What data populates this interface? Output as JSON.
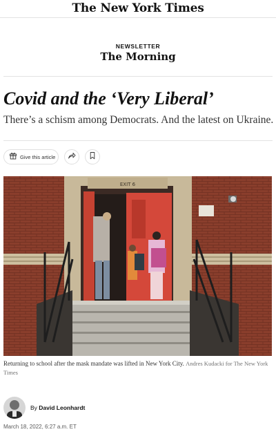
{
  "header": {
    "masthead": "The New York Times"
  },
  "newsletter": {
    "kicker": "NEWSLETTER",
    "title": "The Morning"
  },
  "article": {
    "headline": "Covid and the ‘Very Liberal’",
    "summary": "There’s a schism among Democrats. And the latest on Ukraine."
  },
  "actions": {
    "give_label": "Give this article",
    "give_icon": "gift-icon",
    "share_icon": "share-icon",
    "save_icon": "bookmark-icon"
  },
  "photo": {
    "sign": "EXIT 6",
    "caption": "Returning to school after the mask mandate was lifted in New York City.",
    "credit": "Andres Kudacki for The New York Times"
  },
  "author": {
    "by": "By",
    "name": "David Leonhardt"
  },
  "timestamp": "March 18, 2022, 6:27 a.m. ET",
  "colors": {
    "text": "#121212",
    "rule": "#e2e2e2",
    "door": "#d4483a",
    "brick": "#8a3e2c"
  }
}
